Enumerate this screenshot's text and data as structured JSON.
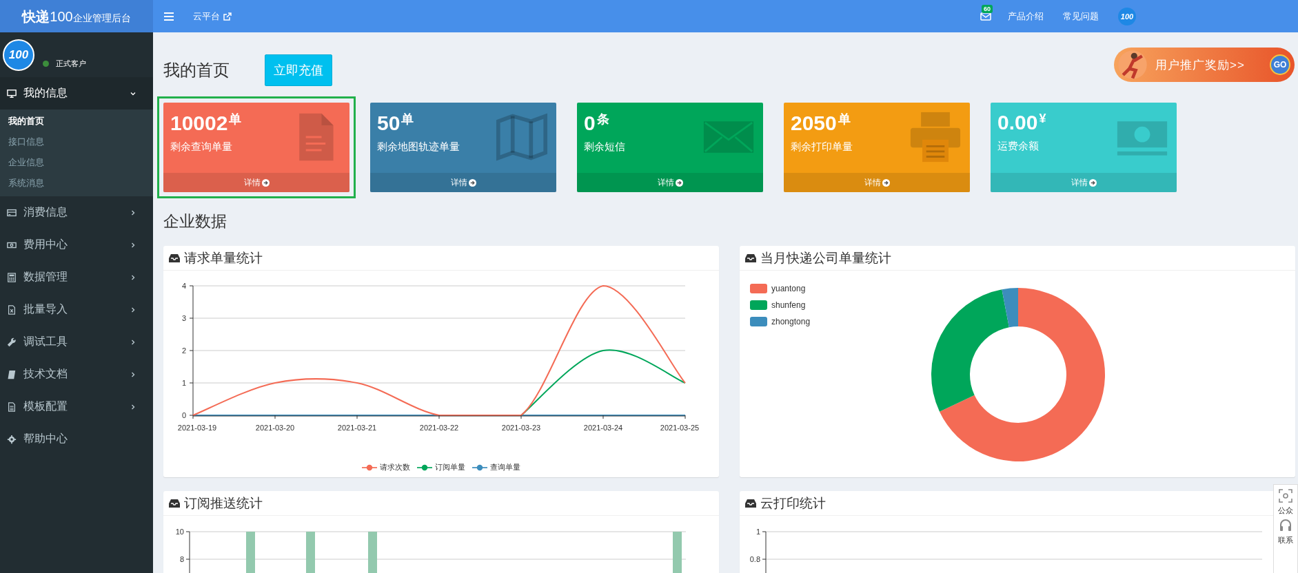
{
  "brand": {
    "name": "**快递**100",
    "suffix": "企业管理后台"
  },
  "topbar": {
    "links": [
      {
        "label": "云平台"
      }
    ],
    "mail_badge": "60",
    "right_links": [
      {
        "label": "产品介绍"
      },
      {
        "label": "常见问题"
      }
    ],
    "avatar": "100"
  },
  "user": {
    "avatar": "100",
    "status": "正式客户",
    "online": true
  },
  "sidebar": {
    "items": [
      {
        "label": "我的信息",
        "kind": "group",
        "expanded": true,
        "children": [
          {
            "label": "我的首页",
            "selected": true
          },
          {
            "label": "接口信息",
            "selected": false
          },
          {
            "label": "企业信息",
            "selected": false
          },
          {
            "label": "系统消息",
            "selected": false
          }
        ]
      },
      {
        "label": "消费信息",
        "kind": "group",
        "expanded": false
      },
      {
        "label": "费用中心",
        "kind": "group",
        "expanded": false
      },
      {
        "label": "数据管理",
        "kind": "group",
        "expanded": false
      },
      {
        "label": "批量导入",
        "kind": "group",
        "expanded": false
      },
      {
        "label": "调试工具",
        "kind": "group",
        "expanded": false
      },
      {
        "label": "技术文档",
        "kind": "group",
        "expanded": false
      },
      {
        "label": "模板配置",
        "kind": "group",
        "expanded": false
      },
      {
        "label": "帮助中心",
        "kind": "link"
      }
    ]
  },
  "page": {
    "title": "我的首页",
    "recharge_button": "立即充值",
    "promo": {
      "text": "用户推广奖励>>",
      "go": "GO"
    }
  },
  "cards": [
    {
      "value": "10002",
      "unit": "单",
      "label": "剩余查询单量",
      "footer": "详情",
      "color": "#f46b55",
      "selected": true
    },
    {
      "value": "50",
      "unit": "单",
      "label": "剩余地图轨迹单量",
      "footer": "详情",
      "color": "#3a7fa8",
      "selected": false
    },
    {
      "value": "0",
      "unit": "条",
      "label": "剩余短信",
      "footer": "详情",
      "color": "#00a65a",
      "selected": false
    },
    {
      "value": "2050",
      "unit": "单",
      "label": "剩余打印单量",
      "footer": "详情",
      "color": "#f39c12",
      "selected": false
    },
    {
      "value": "0.00",
      "unit": "¥",
      "label": "运费余额",
      "footer": "详情",
      "color": "#39cccc",
      "selected": false
    }
  ],
  "section_title": "企业数据",
  "panels": [
    {
      "title": "请求单量统计",
      "chart_data": {
        "type": "line",
        "categories": [
          "2021-03-19",
          "2021-03-20",
          "2021-03-21",
          "2021-03-22",
          "2021-03-23",
          "2021-03-24",
          "2021-03-25"
        ],
        "yticks": [
          0,
          1,
          2,
          3,
          4
        ],
        "ylim": [
          0,
          4
        ],
        "grid": true,
        "legend": "bottom",
        "series": [
          {
            "name": "请求次数",
            "color": "#f46b55",
            "values": [
              0,
              1,
              1,
              0,
              0,
              4,
              1
            ]
          },
          {
            "name": "订阅单量",
            "color": "#00a65a",
            "values": [
              null,
              null,
              null,
              null,
              0,
              2,
              1
            ]
          },
          {
            "name": "查询单量",
            "color": "#3c8dbc",
            "values": [
              0,
              0,
              0,
              0,
              0,
              0,
              0
            ]
          }
        ]
      }
    },
    {
      "title": "当月快递公司单量统计",
      "chart_data": {
        "type": "donut",
        "categories": [
          "yuantong",
          "shunfeng",
          "zhongtong"
        ],
        "values": [
          68,
          29,
          3
        ],
        "colors": [
          "#f46b55",
          "#00a65a",
          "#3c8dbc"
        ],
        "legend": "top-left"
      }
    },
    {
      "title": "订阅推送统计",
      "ticks": [
        "10",
        "8"
      ]
    },
    {
      "title": "云打印统计",
      "ticks": [
        "1",
        "0.8"
      ]
    }
  ],
  "float_widget": {
    "items": [
      {
        "label": "公众"
      },
      {
        "label": "联系"
      }
    ]
  }
}
